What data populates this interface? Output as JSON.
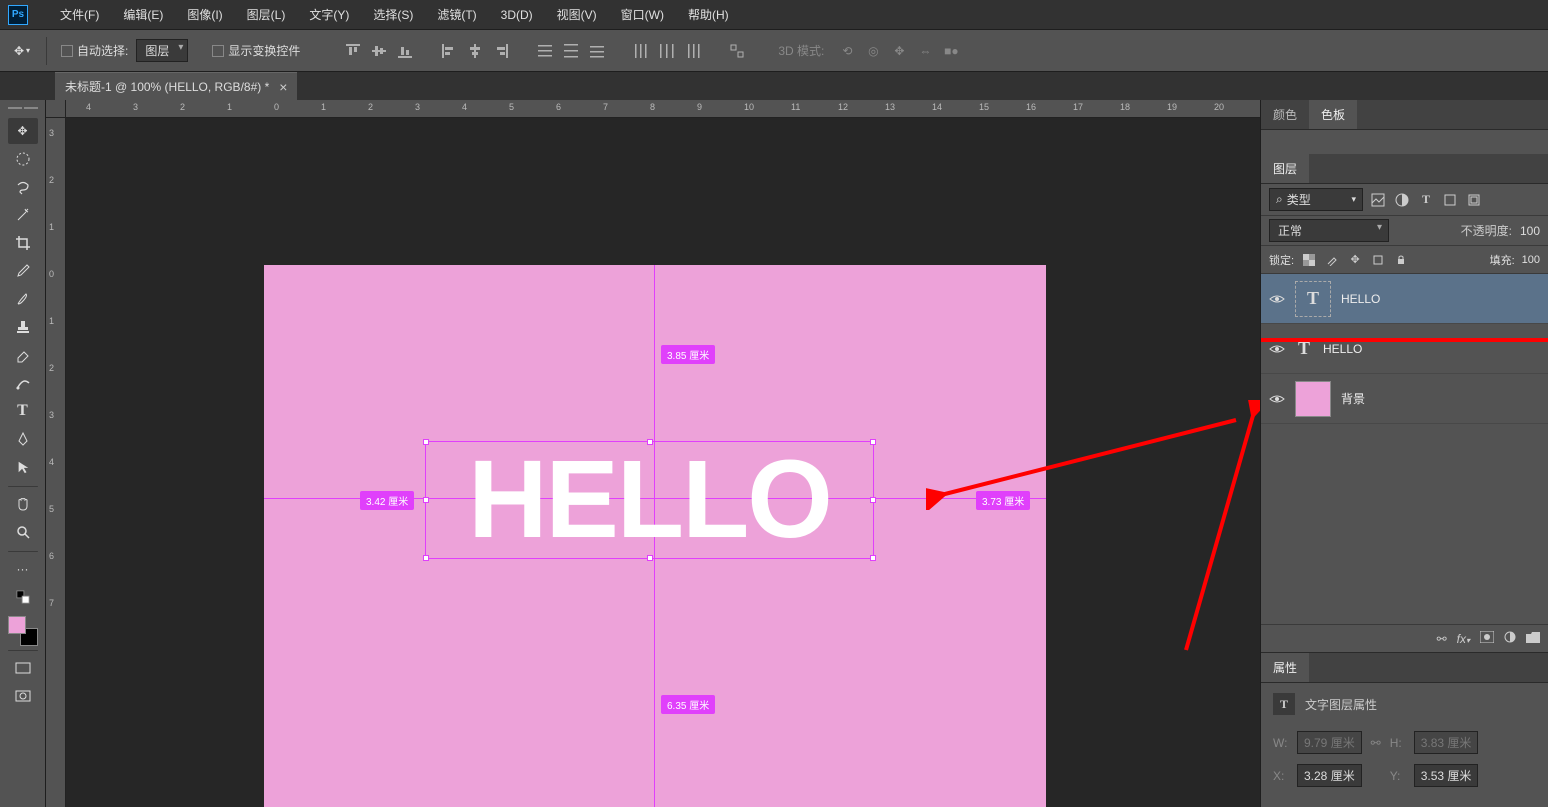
{
  "menu": {
    "items": [
      "文件(F)",
      "编辑(E)",
      "图像(I)",
      "图层(L)",
      "文字(Y)",
      "选择(S)",
      "滤镜(T)",
      "3D(D)",
      "视图(V)",
      "窗口(W)",
      "帮助(H)"
    ]
  },
  "options": {
    "auto_select": "自动选择:",
    "auto_target": "图层",
    "show_transform": "显示变换控件",
    "mode3d": "3D 模式:"
  },
  "tab": {
    "title": "未标题-1 @ 100% (HELLO, RGB/8#) *"
  },
  "ruler_h": [
    4,
    3,
    2,
    1,
    0,
    1,
    2,
    3,
    4,
    5,
    6,
    7,
    8,
    9,
    10,
    11,
    12,
    13,
    14,
    15,
    16,
    17,
    18,
    19,
    20
  ],
  "ruler_v": [
    3,
    2,
    1,
    0,
    1,
    2,
    3,
    4,
    5,
    6,
    7
  ],
  "canvas": {
    "text": "HELLO",
    "measure_top": "3.85 厘米",
    "measure_left": "3.42 厘米",
    "measure_right": "3.73 厘米",
    "measure_bottom": "6.35 厘米"
  },
  "right": {
    "color_tab": "颜色",
    "swatch_tab": "色板",
    "layers_tab": "图层",
    "filter_kind": "类型",
    "blend_mode": "正常",
    "opacity_label": "不透明度:",
    "opacity_value": "100",
    "lock_label": "锁定:",
    "fill_label": "填充:",
    "fill_value": "100",
    "layers": [
      {
        "name": "HELLO",
        "type": "text-dashed",
        "selected": true
      },
      {
        "name": "HELLO",
        "type": "text",
        "selected": false
      },
      {
        "name": "背景",
        "type": "bg",
        "selected": false
      }
    ],
    "prop_tab": "属性",
    "prop_title": "文字图层属性",
    "prop_w_lbl": "W:",
    "prop_w_val": "9.79 厘米",
    "prop_h_lbl": "H:",
    "prop_h_val": "3.83 厘米",
    "prop_x_lbl": "X:",
    "prop_x_val": "3.28 厘米",
    "prop_y_lbl": "Y:",
    "prop_y_val": "3.53 厘米"
  }
}
